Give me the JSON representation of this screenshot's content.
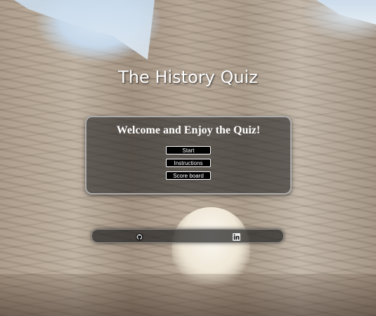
{
  "header": {
    "title": "The History Quiz"
  },
  "panel": {
    "welcome": "Welcome and Enjoy the Quiz!",
    "buttons": {
      "start": "Start",
      "instructions": "Instructions",
      "scoreboard": "Score board"
    }
  },
  "footer": {
    "icons": [
      "github-icon",
      "linkedin-icon"
    ]
  },
  "colors": {
    "panel_bg": "#282828",
    "button_bg": "#000000",
    "button_text": "#ffffff",
    "title_text": "#ffffff"
  }
}
